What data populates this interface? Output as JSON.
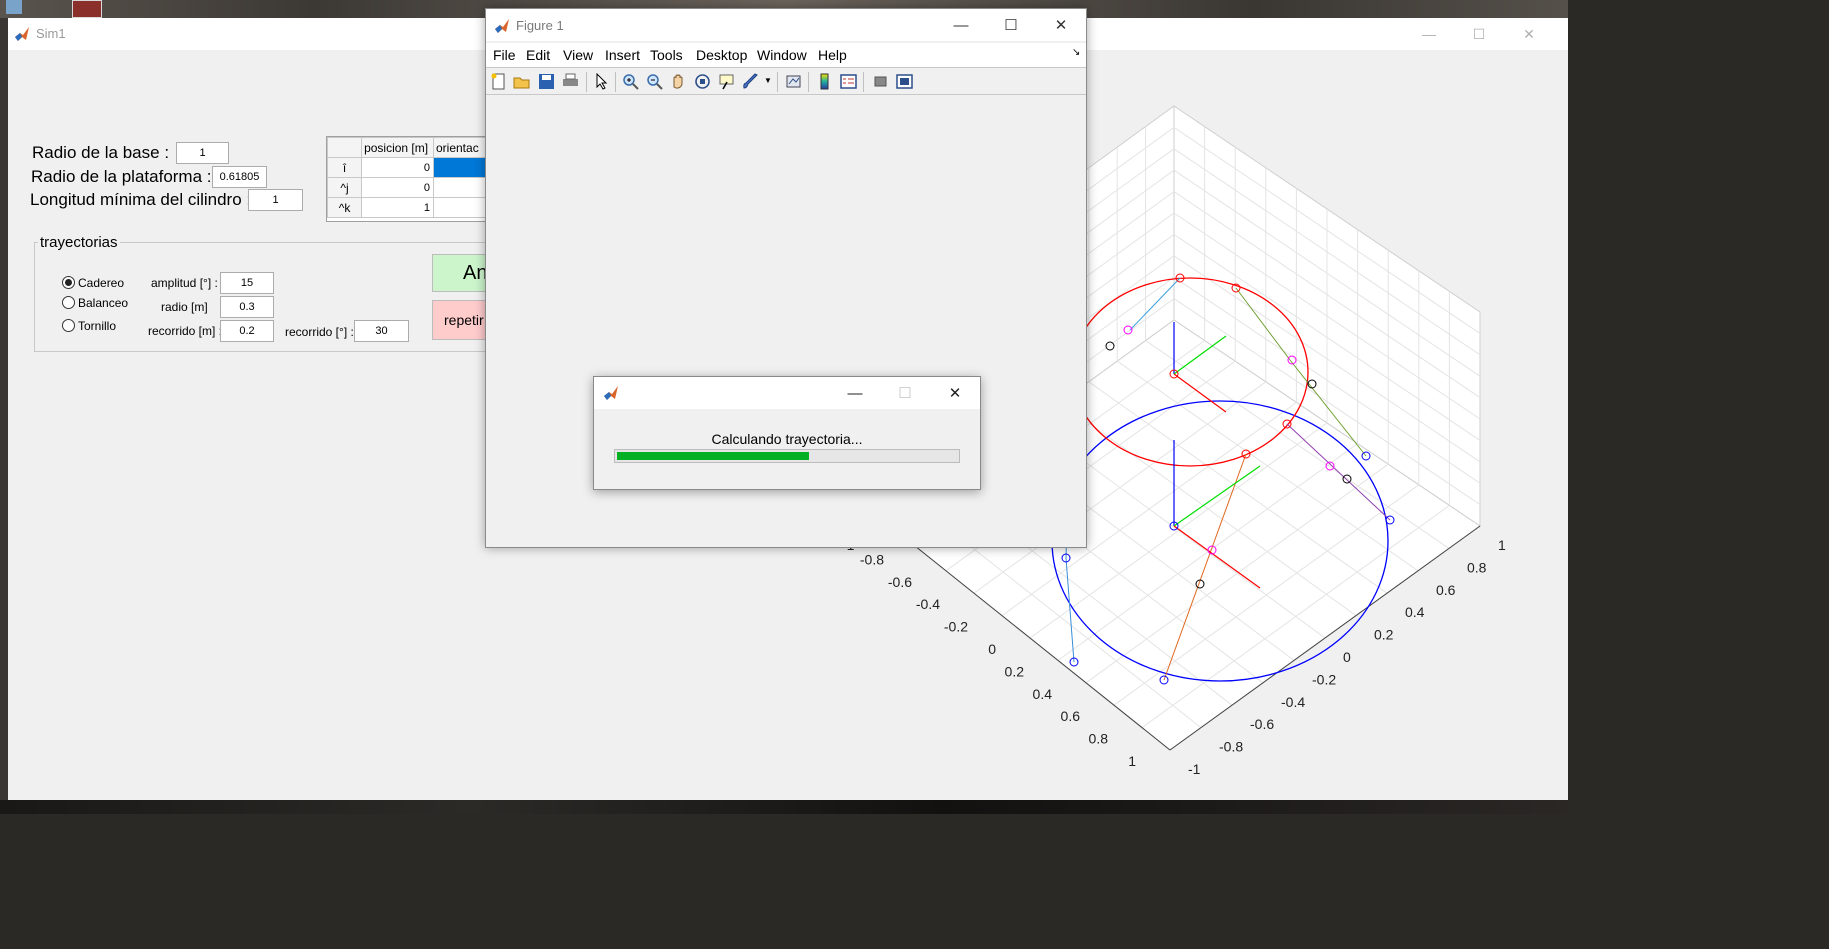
{
  "sim_window": {
    "title": "Sim1",
    "base_radius": {
      "label": "Radio de la base :",
      "value": "1"
    },
    "platform_radius": {
      "label": "Radio de la plataforma :",
      "value": "0.61805"
    },
    "min_cylinder_length": {
      "label": "Longitud mínima del cilindro :",
      "value": "1"
    },
    "table": {
      "columns": [
        "posicion [m]",
        "orientac"
      ],
      "rows": [
        {
          "label": "î",
          "posicion": "0"
        },
        {
          "label": "^j",
          "posicion": "0"
        },
        {
          "label": "^k",
          "posicion": "1"
        }
      ]
    },
    "trajectories": {
      "title": "trayectorias",
      "options": [
        {
          "label": "Cadereo",
          "selected": true
        },
        {
          "label": "Balanceo",
          "selected": false
        },
        {
          "label": "Tornillo",
          "selected": false
        }
      ],
      "amplitude": {
        "label": "amplitud [°] :",
        "value": "15"
      },
      "radius": {
        "label": "radio [m]",
        "value": "0.3"
      },
      "travel_m": {
        "label": "recorrido [m] :",
        "value": "0.2"
      },
      "travel_deg": {
        "label": "recorrido [°] :",
        "value": "30"
      }
    },
    "button_green_label": "An",
    "button_pink_label": "repetir"
  },
  "figure_window": {
    "title": "Figure 1",
    "menu": [
      "File",
      "Edit",
      "View",
      "Insert",
      "Tools",
      "Desktop",
      "Window",
      "Help"
    ],
    "toolbar_icons": [
      "new-figure-icon",
      "open-file-icon",
      "save-icon",
      "print-icon",
      "pointer-icon",
      "zoom-in-icon",
      "zoom-out-icon",
      "pan-icon",
      "rotate-3d-icon",
      "data-cursor-icon",
      "brush-icon",
      "link-plot-icon",
      "colorbar-icon",
      "legend-icon",
      "hide-plot-tools-icon",
      "show-plot-tools-icon"
    ]
  },
  "progress_dialog": {
    "message": "Calculando trayectoria...",
    "progress": 0.56
  },
  "axes3d": {
    "x_ticks": [
      "-0.8",
      "-0.6",
      "-0.4",
      "-0.2",
      "0",
      "0.2",
      "0.4",
      "0.6",
      "0.8",
      "1"
    ],
    "y_ticks": [
      "1",
      "0.8",
      "0.6",
      "0.4",
      "0.2",
      "0",
      "-0.2",
      "-0.4",
      "-0.6",
      "-0.8",
      "-1"
    ],
    "partial_tick": "-1",
    "colors": {
      "base": "#0000ff",
      "platform": "#ff0000",
      "x_axis": "#ff0000",
      "y_axis": "#00cc00",
      "z_axis": "#0000ff"
    }
  }
}
